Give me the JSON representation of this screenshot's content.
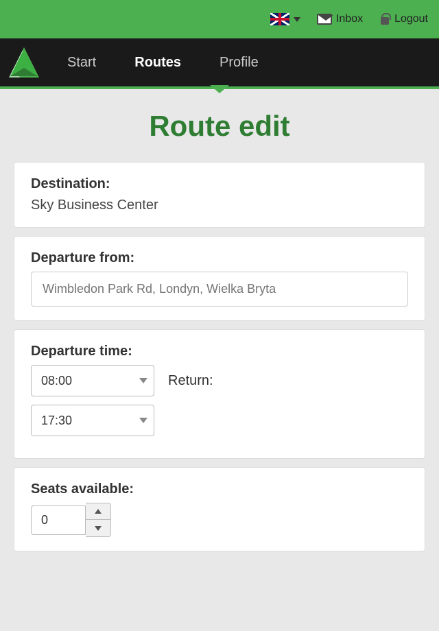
{
  "topbar": {
    "inbox_label": "Inbox",
    "logout_label": "Logout"
  },
  "nav": {
    "start_label": "Start",
    "routes_label": "Routes",
    "profile_label": "Profile"
  },
  "page": {
    "title": "Route edit"
  },
  "form": {
    "destination_label": "Destination:",
    "destination_value": "Sky Business Center",
    "departure_from_label": "Departure from:",
    "departure_from_placeholder": "Wimbledon Park Rd, Londyn, Wielka Bryta",
    "departure_time_label": "Departure time:",
    "time_go": "08:00",
    "time_return": "17:30",
    "return_label": "Return:",
    "seats_label": "Seats available:",
    "seats_value": "0"
  }
}
